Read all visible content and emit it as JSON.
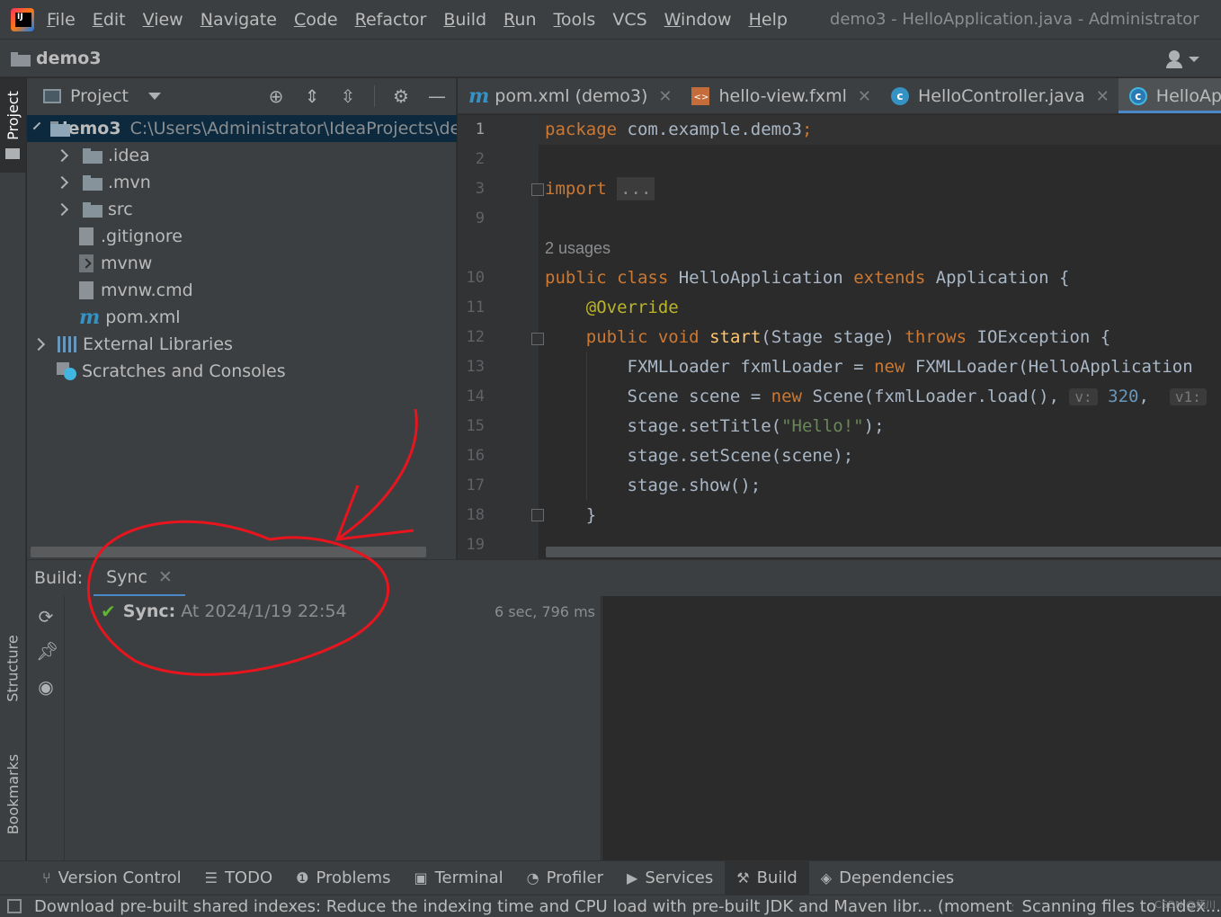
{
  "menubar": {
    "items": [
      {
        "label": "File",
        "mnemonic": "F",
        "rest": "ile"
      },
      {
        "label": "Edit",
        "mnemonic": "E",
        "rest": "dit"
      },
      {
        "label": "View",
        "mnemonic": "V",
        "rest": "iew"
      },
      {
        "label": "Navigate",
        "mnemonic": "N",
        "rest": "avigate"
      },
      {
        "label": "Code",
        "mnemonic": "C",
        "rest": "ode"
      },
      {
        "label": "Refactor",
        "mnemonic": "R",
        "rest": "efactor"
      },
      {
        "label": "Build",
        "mnemonic": "B",
        "rest": "uild"
      },
      {
        "label": "Run",
        "mnemonic": "R",
        "rest": "un"
      },
      {
        "label": "Tools",
        "mnemonic": "T",
        "rest": "ools"
      },
      {
        "label": "VCS",
        "mnemonic": "",
        "rest": "VCS"
      },
      {
        "label": "Window",
        "mnemonic": "W",
        "rest": "indow"
      },
      {
        "label": "Help",
        "mnemonic": "H",
        "rest": "elp"
      }
    ],
    "window_title": "demo3 - HelloApplication.java - Administrator"
  },
  "navbar": {
    "project": "demo3"
  },
  "left_stripe": {
    "project": "Project",
    "structure": "Structure",
    "bookmarks": "Bookmarks"
  },
  "project_panel": {
    "title": "Project",
    "root": {
      "name": "demo3",
      "path": "C:\\Users\\Administrator\\IdeaProjects\\der"
    },
    "items": [
      {
        "name": ".idea"
      },
      {
        "name": ".mvn"
      },
      {
        "name": "src"
      },
      {
        "name": ".gitignore"
      },
      {
        "name": "mvnw"
      },
      {
        "name": "mvnw.cmd"
      },
      {
        "name": "pom.xml"
      },
      {
        "name": "External Libraries"
      },
      {
        "name": "Scratches and Consoles"
      }
    ]
  },
  "editor": {
    "tabs": [
      {
        "label": "pom.xml (demo3)"
      },
      {
        "label": "hello-view.fxml"
      },
      {
        "label": "HelloController.java"
      },
      {
        "label": "HelloApplicatic"
      }
    ],
    "line_numbers": [
      "1",
      "2",
      "3",
      "9",
      "10",
      "11",
      "12",
      "13",
      "14",
      "15",
      "16",
      "17",
      "18",
      "19"
    ],
    "usages": "2 usages",
    "code": {
      "l1_kw": "package",
      "l1_rest": " com.example.demo3",
      "l1_semi": ";",
      "l3_kw": "import",
      "l3_fold": "...",
      "l10_kw": "public class",
      "l10_name": " HelloApplication ",
      "l10_ext": "extends",
      "l10_rest": " Application {",
      "l11_ann": "@Override",
      "l12_kw": "public void",
      "l12_fn": "start",
      "l12_args": "(Stage stage) ",
      "l12_throws": "throws",
      "l12_rest": " IOException {",
      "l13_a": "FXMLLoader fxmlLoader = ",
      "l13_new": "new",
      "l13_b": " FXMLLoader(HelloApplication",
      "l14_a": "Scene scene = ",
      "l14_new": "new",
      "l14_b": " Scene(fxmlLoader.load(), ",
      "l14_hint_v": "v:",
      "l14_num": "320",
      "l14_c": ", ",
      "l14_hint_v1": "v1:",
      "l15_a": "stage.setTitle(",
      "l15_str": "\"Hello!\"",
      "l15_b": ");",
      "l16": "stage.setScene(scene);",
      "l17": "stage.show();",
      "l18": "}"
    }
  },
  "build": {
    "label": "Build:",
    "tab": "Sync",
    "sync_label": "Sync:",
    "sync_time": "At 2024/1/19 22:54",
    "duration": "6 sec, 796 ms"
  },
  "bottom_bar": {
    "items": [
      {
        "label": "Version Control",
        "icon": "branch-icon"
      },
      {
        "label": "TODO",
        "icon": "list-icon"
      },
      {
        "label": "Problems",
        "icon": "info-icon"
      },
      {
        "label": "Terminal",
        "icon": "terminal-icon"
      },
      {
        "label": "Profiler",
        "icon": "profiler-icon"
      },
      {
        "label": "Services",
        "icon": "services-icon"
      },
      {
        "label": "Build",
        "icon": "hammer-icon"
      },
      {
        "label": "Dependencies",
        "icon": "layers-icon"
      }
    ]
  },
  "status_bar": {
    "message": "Download pre-built shared indexes: Reduce the indexing time and CPU load with pre-built JDK and Maven libr... (moments agc",
    "right": "Scanning files to index...",
    "watermark": "CSDN @栖川"
  },
  "colors": {
    "accent": "#4a88c7",
    "annotation": "#e8141e",
    "success": "#5fb832"
  }
}
